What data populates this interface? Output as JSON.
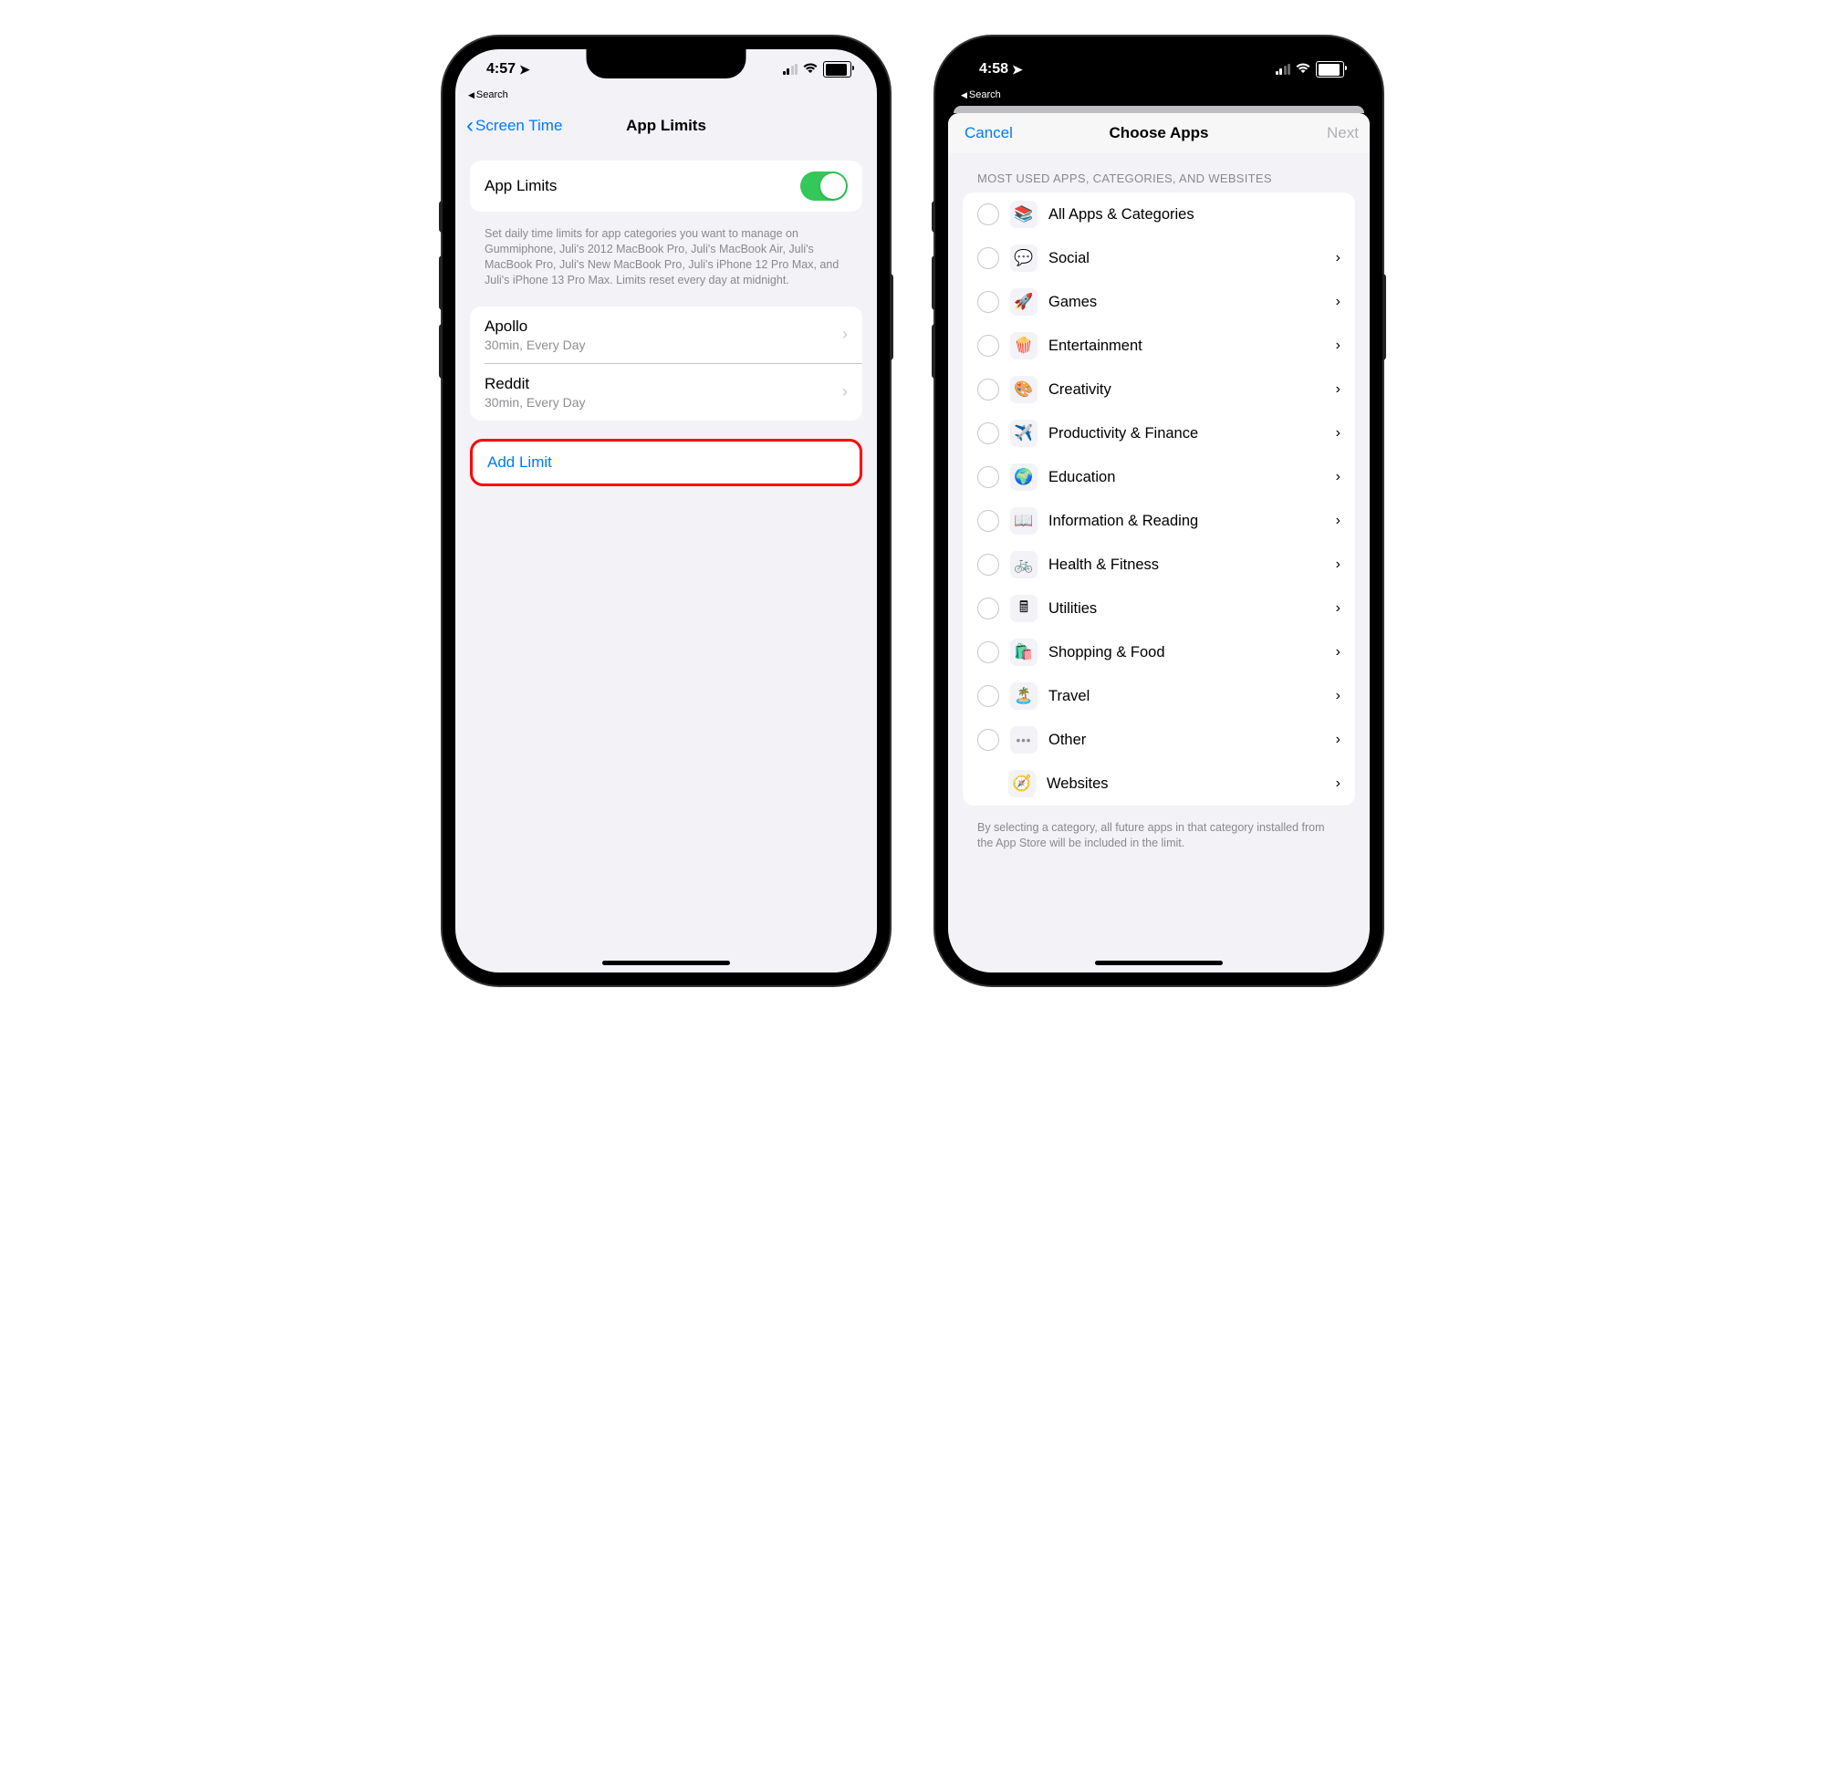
{
  "left": {
    "status": {
      "time": "4:57",
      "breadcrumb": "Search"
    },
    "nav": {
      "back": "Screen Time",
      "title": "App Limits"
    },
    "toggleRow": {
      "label": "App Limits"
    },
    "footer": "Set daily time limits for app categories you want to manage on Gummiphone, Juli's 2012 MacBook Pro, Juli's MacBook Air, Juli's MacBook Pro, Juli's New MacBook Pro, Juli's iPhone 12 Pro Max, and Juli's iPhone 13 Pro Max. Limits reset every day at midnight.",
    "limits": [
      {
        "name": "Apollo",
        "detail": "30min, Every Day"
      },
      {
        "name": "Reddit",
        "detail": "30min, Every Day"
      }
    ],
    "addLimit": "Add Limit"
  },
  "right": {
    "status": {
      "time": "4:58",
      "breadcrumb": "Search"
    },
    "nav": {
      "cancel": "Cancel",
      "title": "Choose Apps",
      "next": "Next"
    },
    "header": "MOST USED APPS, CATEGORIES, AND WEBSITES",
    "categories": [
      {
        "label": "All Apps & Categories",
        "icon": "📚",
        "chevron": false,
        "radio": true
      },
      {
        "label": "Social",
        "icon": "💬",
        "chevron": true,
        "radio": true
      },
      {
        "label": "Games",
        "icon": "🚀",
        "chevron": true,
        "radio": true
      },
      {
        "label": "Entertainment",
        "icon": "🍿",
        "chevron": true,
        "radio": true
      },
      {
        "label": "Creativity",
        "icon": "🎨",
        "chevron": true,
        "radio": true
      },
      {
        "label": "Productivity & Finance",
        "icon": "✈️",
        "chevron": true,
        "radio": true
      },
      {
        "label": "Education",
        "icon": "🌍",
        "chevron": true,
        "radio": true
      },
      {
        "label": "Information & Reading",
        "icon": "📖",
        "chevron": true,
        "radio": true
      },
      {
        "label": "Health & Fitness",
        "icon": "🚲",
        "chevron": true,
        "radio": true
      },
      {
        "label": "Utilities",
        "icon": "🖩",
        "chevron": true,
        "radio": true
      },
      {
        "label": "Shopping & Food",
        "icon": "🛍️",
        "chevron": true,
        "radio": true
      },
      {
        "label": "Travel",
        "icon": "🏝️",
        "chevron": true,
        "radio": true
      },
      {
        "label": "Other",
        "icon": "•••",
        "chevron": true,
        "radio": true
      },
      {
        "label": "Websites",
        "icon": "🧭",
        "chevron": true,
        "radio": false
      }
    ],
    "footer": "By selecting a category, all future apps in that category installed from the App Store will be included in the limit."
  }
}
